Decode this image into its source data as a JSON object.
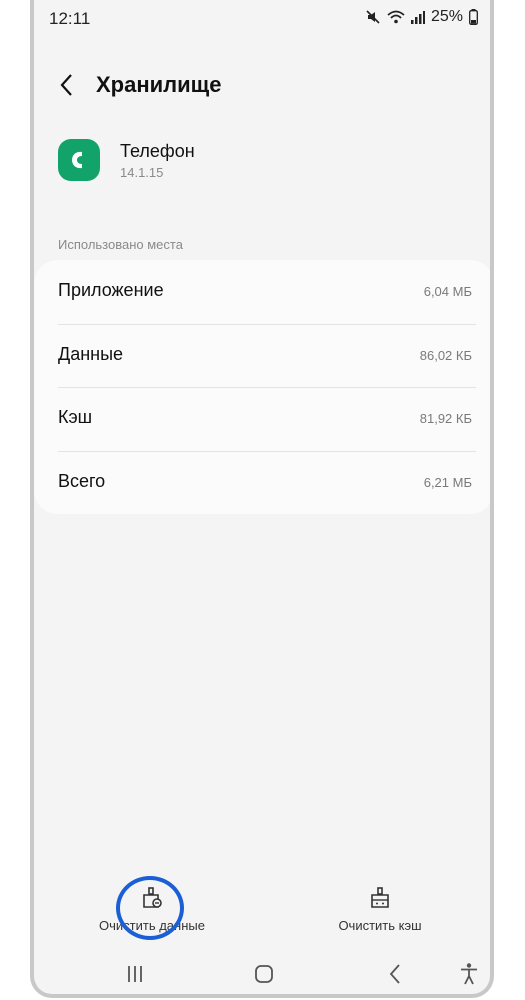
{
  "status_bar": {
    "time": "12:11",
    "battery": "25%"
  },
  "header": {
    "title": "Хранилище"
  },
  "app": {
    "name": "Телефон",
    "version": "14.1.15"
  },
  "storage": {
    "section_label": "Использовано места",
    "rows": [
      {
        "label": "Приложение",
        "value": "6,04 МБ"
      },
      {
        "label": "Данные",
        "value": "86,02 КБ"
      },
      {
        "label": "Кэш",
        "value": "81,92 КБ"
      },
      {
        "label": "Всего",
        "value": "6,21 МБ"
      }
    ]
  },
  "actions": {
    "clear_data": "Очистить данные",
    "clear_cache": "Очистить кэш"
  },
  "colors": {
    "app_icon": "#12a36b",
    "highlight": "#1a5fd6",
    "background": "#f4f4f4"
  }
}
